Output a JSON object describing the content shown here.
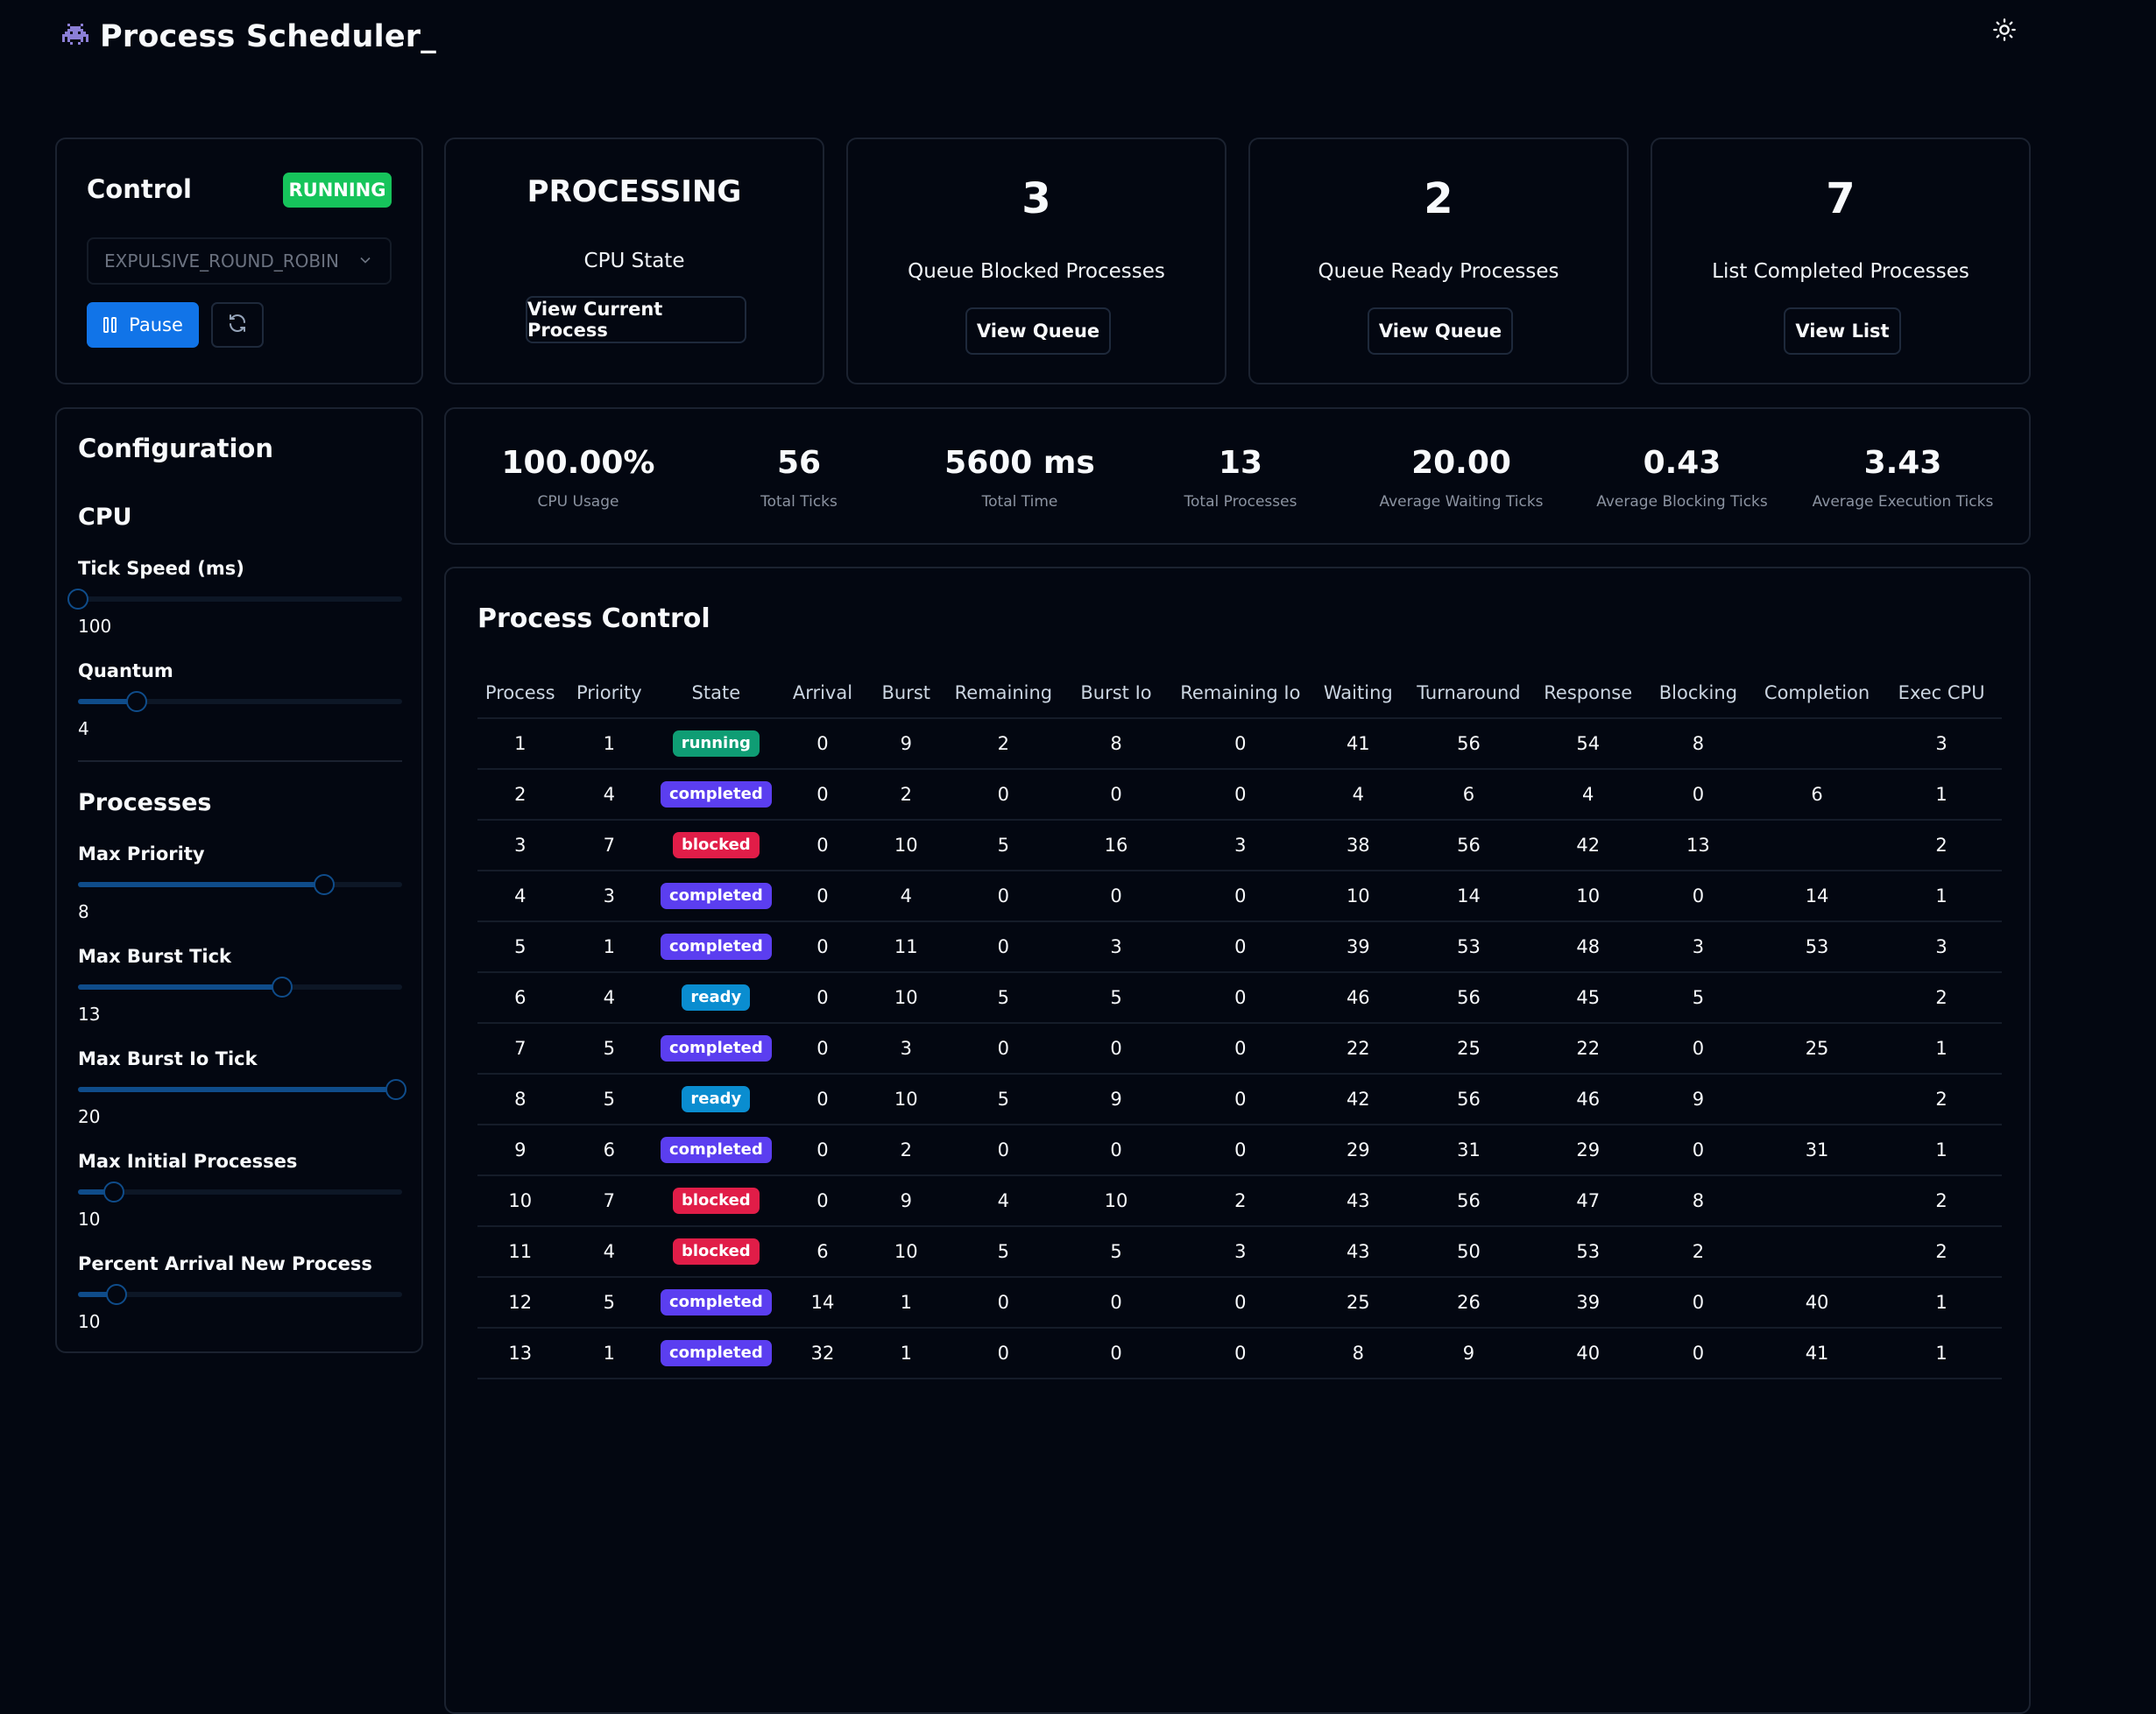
{
  "app": {
    "title": "Process Scheduler_"
  },
  "icons": {
    "logo": "alien-invader-icon",
    "theme": "sun-icon",
    "pause": "pause-icon",
    "refresh": "refresh-icon",
    "chevron": "chevron-down-icon"
  },
  "colors": {
    "running": "#16c45b",
    "primary": "#1174e8",
    "completed": "#5b3ef0",
    "blocked": "#e11d48",
    "ready": "#0a8dd0",
    "state_running": "#0f9d74"
  },
  "control": {
    "title": "Control",
    "status": "RUNNING",
    "algorithm": "EXPULSIVE_ROUND_ROBIN",
    "pause_label": "Pause"
  },
  "cpu_state": {
    "value": "PROCESSING",
    "label": "CPU State",
    "button": "View Current Process"
  },
  "queue_blocked": {
    "value": "3",
    "label": "Queue Blocked Processes",
    "button": "View Queue"
  },
  "queue_ready": {
    "value": "2",
    "label": "Queue Ready Processes",
    "button": "View Queue"
  },
  "completed_list": {
    "value": "7",
    "label": "List Completed Processes",
    "button": "View List"
  },
  "metrics": [
    {
      "value": "100.00%",
      "label": "CPU Usage"
    },
    {
      "value": "56",
      "label": "Total Ticks"
    },
    {
      "value": "5600 ms",
      "label": "Total Time"
    },
    {
      "value": "13",
      "label": "Total Processes"
    },
    {
      "value": "20.00",
      "label": "Average Waiting Ticks"
    },
    {
      "value": "0.43",
      "label": "Average Blocking Ticks"
    },
    {
      "value": "3.43",
      "label": "Average Execution Ticks"
    }
  ],
  "configuration": {
    "title": "Configuration",
    "cpu_section": "CPU",
    "processes_section": "Processes",
    "sliders": [
      {
        "label": "Tick Speed (ms)",
        "value": "100",
        "fraction": 0.0
      },
      {
        "label": "Quantum",
        "value": "4",
        "fraction": 0.18
      },
      {
        "label": "Max Priority",
        "value": "8",
        "fraction": 0.76
      },
      {
        "label": "Max Burst Tick",
        "value": "13",
        "fraction": 0.63
      },
      {
        "label": "Max Burst Io Tick",
        "value": "20",
        "fraction": 0.98
      },
      {
        "label": "Max Initial Processes",
        "value": "10",
        "fraction": 0.11
      },
      {
        "label": "Percent Arrival New Process",
        "value": "10",
        "fraction": 0.12
      }
    ]
  },
  "process_control": {
    "title": "Process Control",
    "columns": [
      "Process",
      "Priority",
      "State",
      "Arrival",
      "Burst",
      "Remaining",
      "Burst Io",
      "Remaining Io",
      "Waiting",
      "Turnaround",
      "Response",
      "Blocking",
      "Completion",
      "Exec CPU"
    ],
    "rows": [
      [
        "1",
        "1",
        "running",
        "0",
        "9",
        "2",
        "8",
        "0",
        "41",
        "56",
        "54",
        "8",
        "",
        "3"
      ],
      [
        "2",
        "4",
        "completed",
        "0",
        "2",
        "0",
        "0",
        "0",
        "4",
        "6",
        "4",
        "0",
        "6",
        "1"
      ],
      [
        "3",
        "7",
        "blocked",
        "0",
        "10",
        "5",
        "16",
        "3",
        "38",
        "56",
        "42",
        "13",
        "",
        "2"
      ],
      [
        "4",
        "3",
        "completed",
        "0",
        "4",
        "0",
        "0",
        "0",
        "10",
        "14",
        "10",
        "0",
        "14",
        "1"
      ],
      [
        "5",
        "1",
        "completed",
        "0",
        "11",
        "0",
        "3",
        "0",
        "39",
        "53",
        "48",
        "3",
        "53",
        "3"
      ],
      [
        "6",
        "4",
        "ready",
        "0",
        "10",
        "5",
        "5",
        "0",
        "46",
        "56",
        "45",
        "5",
        "",
        "2"
      ],
      [
        "7",
        "5",
        "completed",
        "0",
        "3",
        "0",
        "0",
        "0",
        "22",
        "25",
        "22",
        "0",
        "25",
        "1"
      ],
      [
        "8",
        "5",
        "ready",
        "0",
        "10",
        "5",
        "9",
        "0",
        "42",
        "56",
        "46",
        "9",
        "",
        "2"
      ],
      [
        "9",
        "6",
        "completed",
        "0",
        "2",
        "0",
        "0",
        "0",
        "29",
        "31",
        "29",
        "0",
        "31",
        "1"
      ],
      [
        "10",
        "7",
        "blocked",
        "0",
        "9",
        "4",
        "10",
        "2",
        "43",
        "56",
        "47",
        "8",
        "",
        "2"
      ],
      [
        "11",
        "4",
        "blocked",
        "6",
        "10",
        "5",
        "5",
        "3",
        "43",
        "50",
        "53",
        "2",
        "",
        "2"
      ],
      [
        "12",
        "5",
        "completed",
        "14",
        "1",
        "0",
        "0",
        "0",
        "25",
        "26",
        "39",
        "0",
        "40",
        "1"
      ],
      [
        "13",
        "1",
        "completed",
        "32",
        "1",
        "0",
        "0",
        "0",
        "8",
        "9",
        "40",
        "0",
        "41",
        "1"
      ]
    ]
  }
}
